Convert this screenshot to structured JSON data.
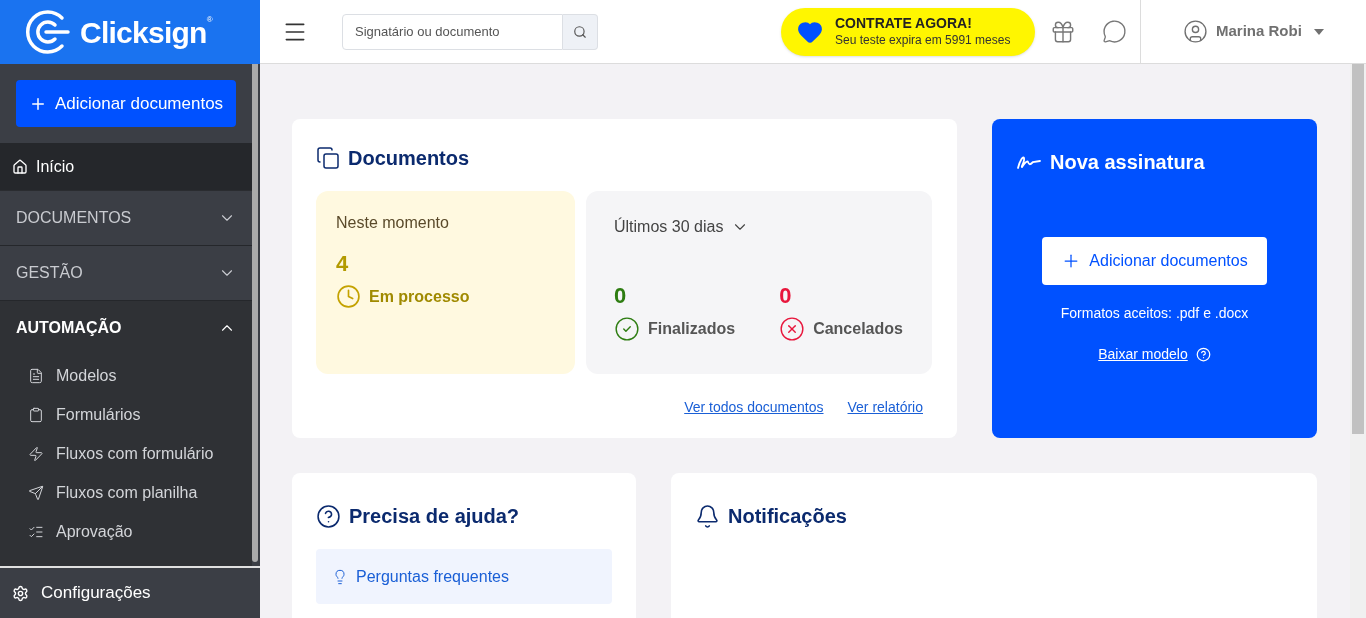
{
  "brand": {
    "name": "Clicksign",
    "mark": "®"
  },
  "sidebar": {
    "add_button": "Adicionar documentos",
    "items": [
      {
        "kind": "link",
        "label": "Início",
        "selected": true
      },
      {
        "kind": "section",
        "label": "DOCUMENTOS",
        "expanded": false
      },
      {
        "kind": "section",
        "label": "GESTÃO",
        "expanded": false
      },
      {
        "kind": "section",
        "label": "AUTOMAÇÃO",
        "expanded": true,
        "children": [
          {
            "label": "Modelos"
          },
          {
            "label": "Formulários"
          },
          {
            "label": "Fluxos com formulário"
          },
          {
            "label": "Fluxos com planilha"
          },
          {
            "label": "Aprovação"
          }
        ]
      }
    ],
    "footer": "Configurações"
  },
  "header": {
    "search": {
      "placeholder": "Signatário ou documento"
    },
    "promo": {
      "title": "CONTRATE AGORA!",
      "subtitle": "Seu teste expira em 5991 meses"
    },
    "user": "Marina Robi"
  },
  "documents": {
    "title": "Documentos",
    "now": {
      "label": "Neste momento",
      "count": "4",
      "status": "Em processo"
    },
    "period": {
      "label": "Últimos 30 dias",
      "stats": [
        {
          "kind": "done",
          "count": "0",
          "label": "Finalizados"
        },
        {
          "kind": "cancelled",
          "count": "0",
          "label": "Cancelados"
        }
      ]
    },
    "links": [
      "Ver todos documentos",
      "Ver relatório"
    ]
  },
  "new_signature": {
    "title": "Nova assinatura",
    "button": "Adicionar documentos",
    "formats": "Formatos aceitos: .pdf e .docx",
    "template_link": "Baixar modelo"
  },
  "help": {
    "title": "Precisa de ajuda?",
    "items": [
      "Perguntas frequentes"
    ]
  },
  "notifications": {
    "title": "Notificações"
  }
}
